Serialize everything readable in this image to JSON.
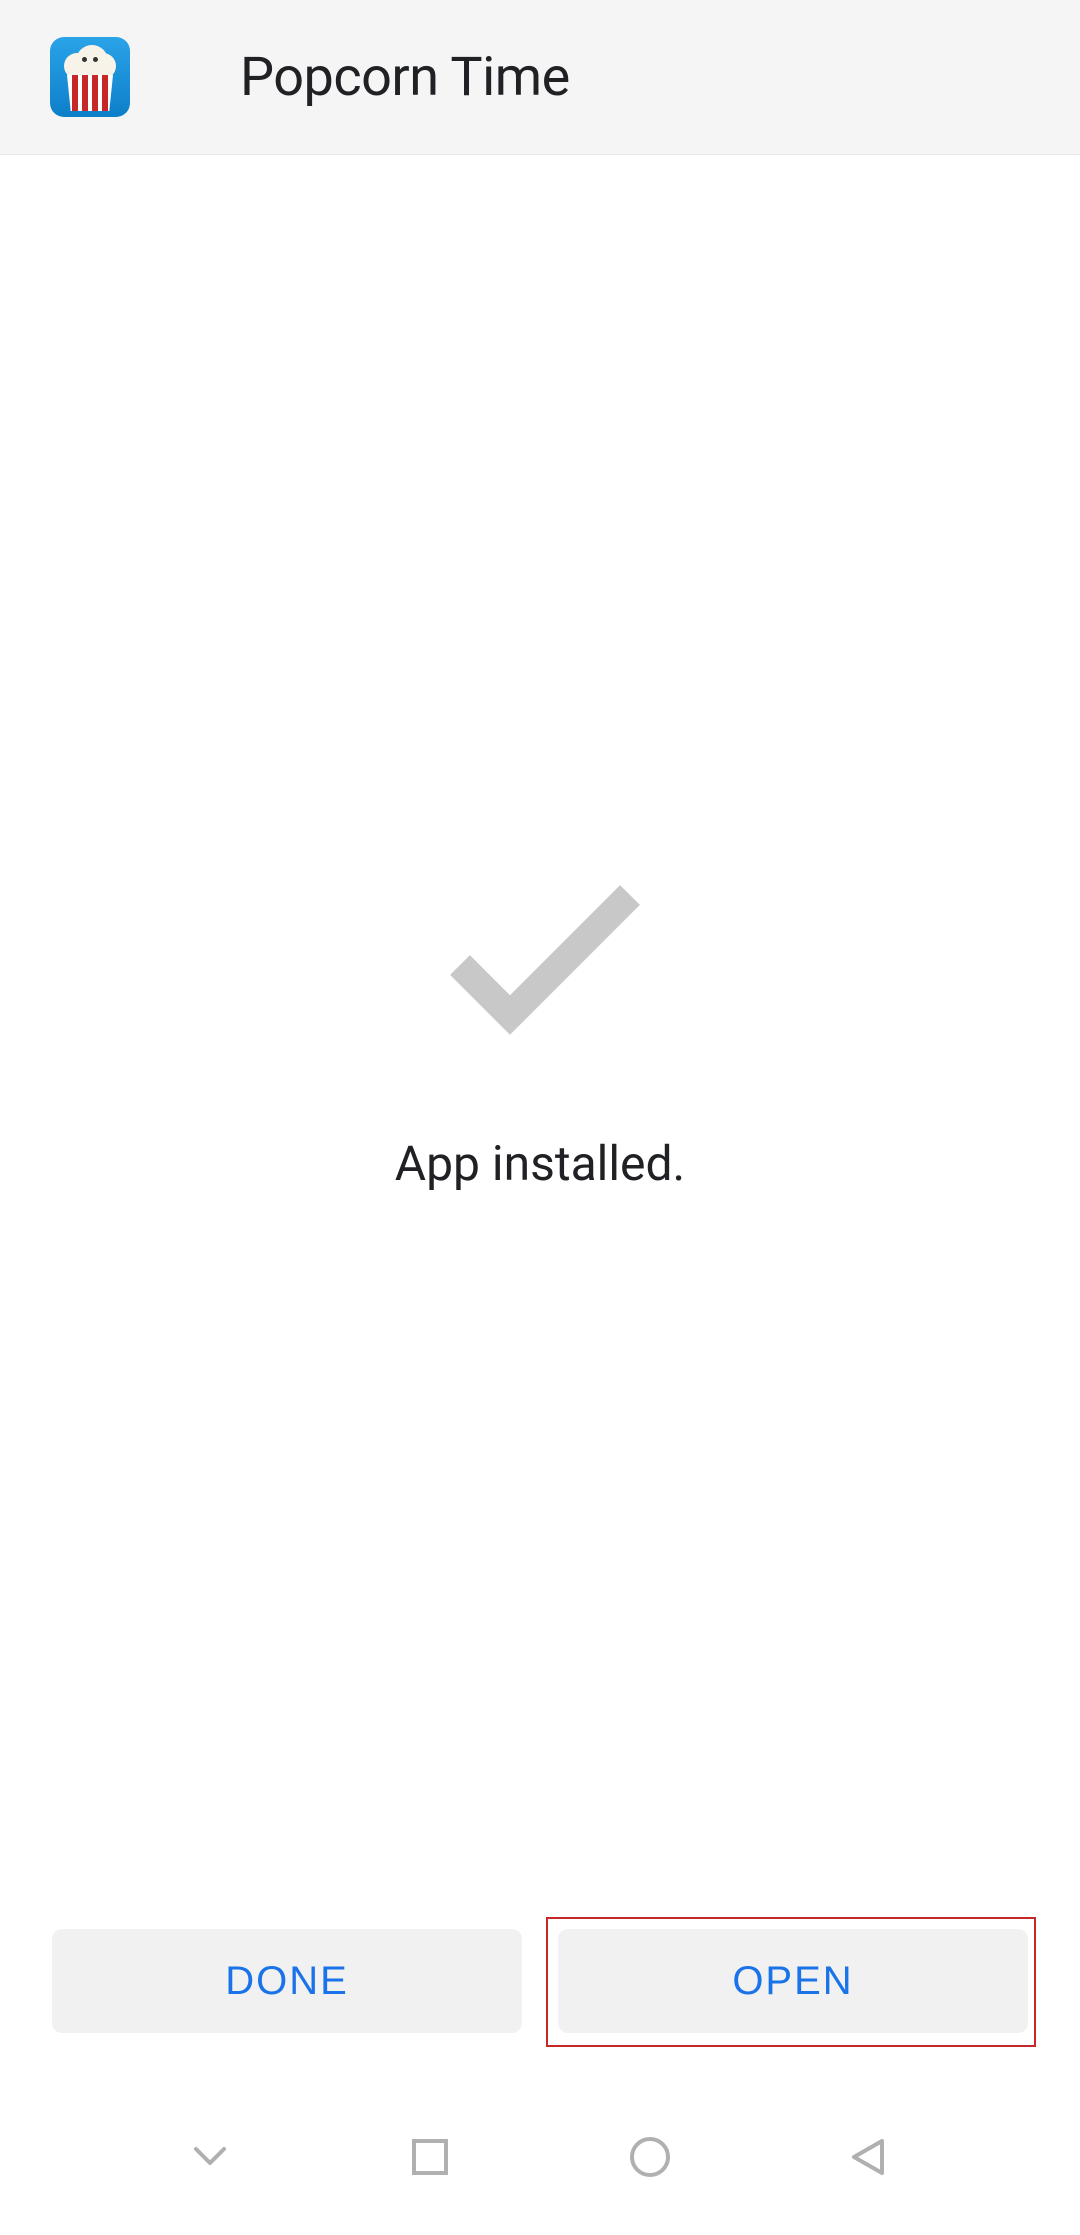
{
  "header": {
    "app_name": "Popcorn Time"
  },
  "main": {
    "status_message": "App installed."
  },
  "buttons": {
    "done_label": "DONE",
    "open_label": "OPEN"
  },
  "icons": {
    "app_icon": "popcorn-time-icon",
    "checkmark": "checkmark-icon",
    "nav_down": "chevron-down-icon",
    "nav_recent": "square-icon",
    "nav_home": "circle-icon",
    "nav_back": "triangle-back-icon"
  },
  "colors": {
    "accent": "#1a73e8",
    "highlight": "#c62828",
    "icon_gray": "#bdbdbd"
  }
}
